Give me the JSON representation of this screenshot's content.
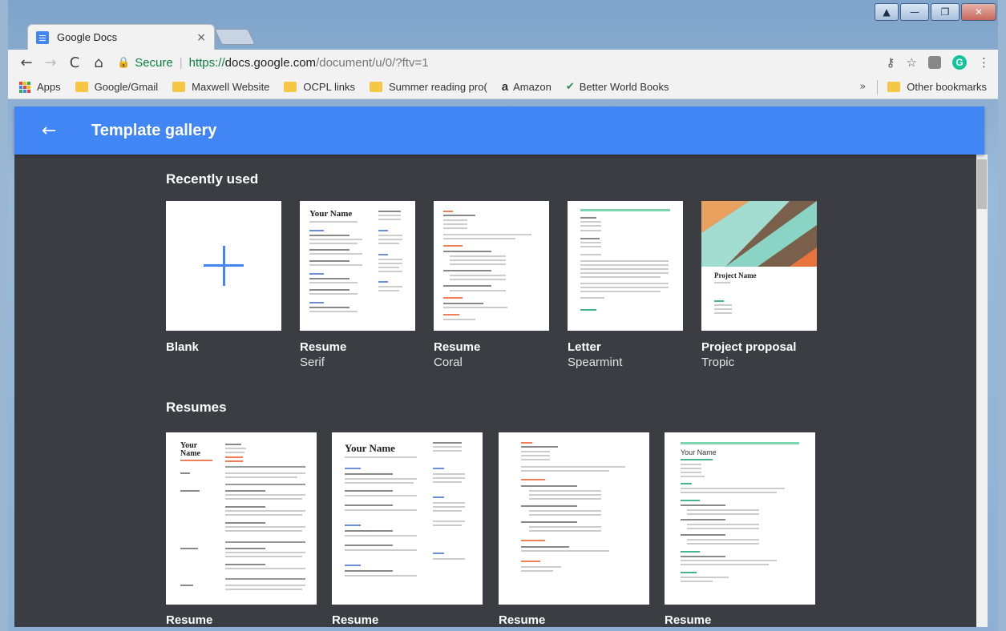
{
  "window": {
    "controls": [
      "▲",
      "—",
      "❐",
      "✕"
    ]
  },
  "tab": {
    "title": "Google Docs",
    "close": "×"
  },
  "toolbar": {
    "back": "←",
    "forward": "→",
    "reload": "C",
    "home": "⌂",
    "lock": "🔒",
    "secure_label": "Secure",
    "separator": "|",
    "url_proto": "https://",
    "url_host": "docs.google.com",
    "url_path": "/document/u/0/?ftv=1",
    "key_icon": "⚷",
    "star_icon": "☆",
    "grammarly": "G",
    "menu_icon": "⋮"
  },
  "bookmarks": {
    "items": [
      "Apps",
      "Google/Gmail",
      "Maxwell Website",
      "OCPL links",
      "Summer reading pro(",
      "Amazon",
      "Better World Books"
    ],
    "amazon_glyph": "a",
    "bwb_glyph": "✔",
    "overflow": "»",
    "other": "Other bookmarks"
  },
  "appbar": {
    "back_icon": "←",
    "title": "Template gallery"
  },
  "sections": {
    "recent": {
      "title": "Recently used",
      "templates": [
        {
          "name": "Blank",
          "style": ""
        },
        {
          "name": "Resume",
          "style": "Serif"
        },
        {
          "name": "Resume",
          "style": "Coral"
        },
        {
          "name": "Letter",
          "style": "Spearmint"
        },
        {
          "name": "Project proposal",
          "style": "Tropic"
        }
      ]
    },
    "resumes": {
      "title": "Resumes",
      "templates": [
        {
          "name": "Resume"
        },
        {
          "name": "Resume"
        },
        {
          "name": "Resume"
        },
        {
          "name": "Resume"
        }
      ]
    }
  },
  "thumbnails": {
    "your_name": "Your Name",
    "your_name_split": [
      "Your",
      "Name"
    ],
    "project_name": "Project Name"
  },
  "colors": {
    "appbar": "#4285f4",
    "gallery_bg": "#3c3d42",
    "coral": "#f27f5a",
    "spearmint": "#46b58b"
  }
}
